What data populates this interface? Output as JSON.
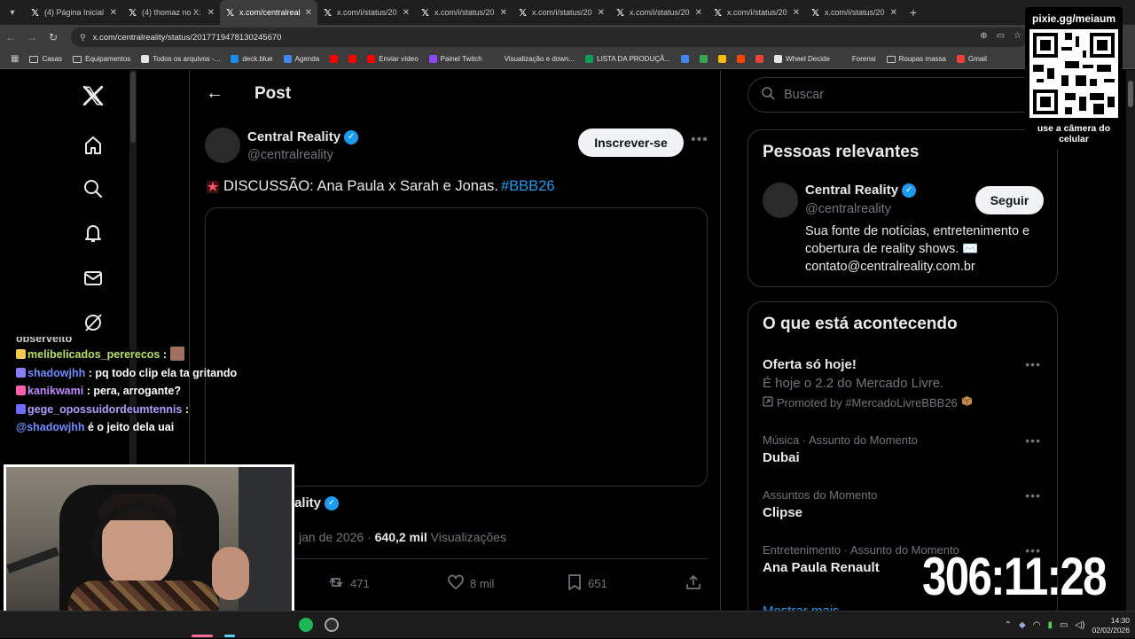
{
  "browser": {
    "tabs": [
      {
        "label": "(4) Página Inicial / X",
        "active": false
      },
      {
        "label": "(4) thomaz no X: \"",
        "active": false
      },
      {
        "label": "x.com/centralreality",
        "active": true
      },
      {
        "label": "x.com/i/status/20",
        "active": false
      },
      {
        "label": "x.com/i/status/20",
        "active": false
      },
      {
        "label": "x.com/i/status/20",
        "active": false
      },
      {
        "label": "x.com/i/status/20",
        "active": false
      },
      {
        "label": "x.com/i/status/20",
        "active": false
      },
      {
        "label": "x.com/i/status/20",
        "active": false
      }
    ],
    "url": "x.com/centralreality/status/2017719478130245670",
    "bookmarks": [
      {
        "label": "Casas",
        "icon": "folder",
        "color": "#c4c7c5"
      },
      {
        "label": "Equipamentos",
        "icon": "folder",
        "color": "#c4c7c5"
      },
      {
        "label": "Todos os arquivos -...",
        "icon": "site",
        "color": "#e3e3e3"
      },
      {
        "label": "deck.blue",
        "icon": "site",
        "color": "#1d8cf0"
      },
      {
        "label": "Agenda",
        "icon": "site",
        "color": "#4285f4"
      },
      {
        "label": "",
        "icon": "youtube",
        "color": "#ff0000"
      },
      {
        "label": "",
        "icon": "youtube",
        "color": "#ff0000"
      },
      {
        "label": "Enviar vídeo",
        "icon": "youtube",
        "color": "#ff0000"
      },
      {
        "label": "Painel Twitch",
        "icon": "twitch",
        "color": "#9146ff"
      },
      {
        "label": "Visualização e down...",
        "icon": "site",
        "color": "#3c3c3c"
      },
      {
        "label": "LISTA DA PRODUÇÃ...",
        "icon": "sheets",
        "color": "#0f9d58"
      },
      {
        "label": "",
        "icon": "site",
        "color": "#4285f4"
      },
      {
        "label": "",
        "icon": "drive",
        "color": "#34a853"
      },
      {
        "label": "",
        "icon": "keep",
        "color": "#fbbc04"
      },
      {
        "label": "",
        "icon": "reddit",
        "color": "#ff4500"
      },
      {
        "label": "",
        "icon": "gmail",
        "color": "#ea4335"
      },
      {
        "label": "Wheel Decide",
        "icon": "site",
        "color": "#e3e3e3"
      },
      {
        "label": "Forensi",
        "icon": "site",
        "color": "#3c3c3c"
      },
      {
        "label": "Roupas massa",
        "icon": "folder",
        "color": "#c4c7c5"
      },
      {
        "label": "Gmail",
        "icon": "gmail",
        "color": "#ea4335"
      }
    ]
  },
  "post": {
    "header_title": "Post",
    "author_name": "Central Reality",
    "author_handle": "@centralreality",
    "subscribe_label": "Inscrever-se",
    "text": "DISCUSSÃO: Ana Paula x Sarah e Jonas.",
    "hashtag": "#BBB26",
    "quoted_name": "ality",
    "date_text": "jan de 2026 ·",
    "views_count": "640,2 mil",
    "views_label": "Visualizações",
    "reposts": "471",
    "likes": "8 mil",
    "bookmarks": "651"
  },
  "sidebar": {
    "search_placeholder": "Buscar",
    "relevant_title": "Pessoas relevantes",
    "relevant": {
      "name": "Central Reality",
      "handle": "@centralreality",
      "bio": "Sua fonte de notícias, entretenimento e cobertura de reality shows. ✉️ contato@centralreality.com.br",
      "follow_label": "Seguir"
    },
    "trends_title": "O que está acontecendo",
    "trends": [
      {
        "title": "Oferta só hoje!",
        "desc": "É hoje o 2.2 do Mercado Livre.",
        "promo": "Promoted by #MercadoLivreBBB26"
      },
      {
        "context": "Música · Assunto do Momento",
        "title": "Dubai"
      },
      {
        "context": "Assuntos do Momento",
        "title": "Clipse"
      },
      {
        "context": "Entretenimento · Assunto do Momento",
        "title": "Ana Paula Renault"
      }
    ],
    "show_more": "Mostrar mais"
  },
  "stream": {
    "chat": [
      {
        "user": "melibelicados_pererecos",
        "message": "",
        "color": "#b8e060"
      },
      {
        "user": "shadowjhh",
        "message": "pq todo clip ela ta gritando",
        "color": "#6d8cff"
      },
      {
        "user": "kanikwami",
        "message": "pera, arrogante?",
        "color": "#c088ff"
      },
      {
        "user": "gege_opossuidordeumtennis",
        "message": "",
        "color": "#b39dff"
      },
      {
        "mention": "@shadowjhh",
        "message": "é o jeito dela uai"
      }
    ],
    "chat_partial_top": "observéito",
    "qr_url": "pixie.gg/meiaum",
    "qr_caption": "use a câmera do celular",
    "timer": "306:11:28"
  },
  "taskbar": {
    "time": "14:30",
    "date": "02/02/2026"
  },
  "colors": {
    "accent": "#1d9bf0",
    "background": "#000000",
    "border": "#2f3336",
    "muted": "#71767b"
  }
}
